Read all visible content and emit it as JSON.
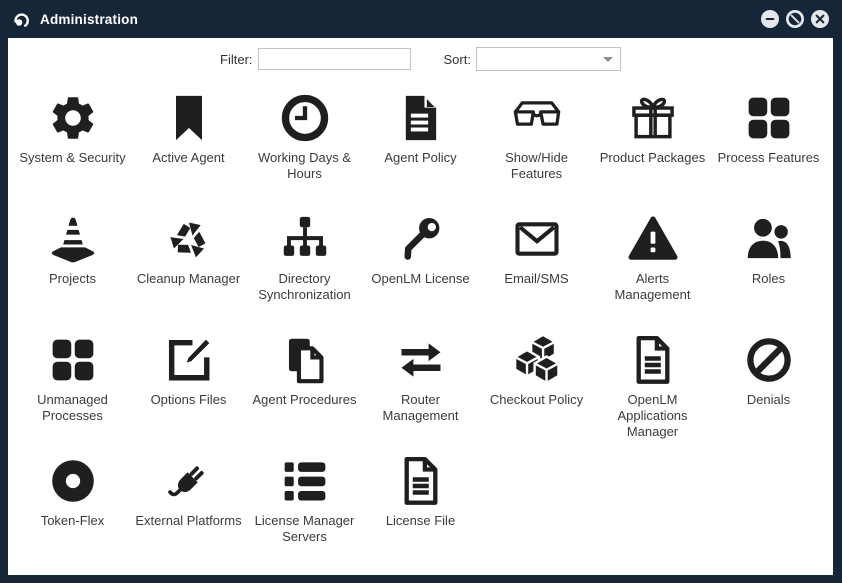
{
  "window": {
    "title": "Administration",
    "logo_icon": "openlm-logo-icon",
    "controls": [
      {
        "id": "minimize",
        "icon": "minus-circle"
      },
      {
        "id": "block",
        "icon": "slashed-circle"
      },
      {
        "id": "close",
        "icon": "x-circle"
      }
    ]
  },
  "toolbar": {
    "filter_label": "Filter:",
    "filter_value": "",
    "sort_label": "Sort:",
    "sort_value": ""
  },
  "colors": {
    "titlebar_bg": "#162639",
    "content_bg": "#FFFFFF",
    "icon": "#1F1F1F",
    "label_text": "#3B3B3B",
    "control_bg": "#E4E8EB",
    "field_border": "#BFC3C7"
  },
  "grid": {
    "items": [
      {
        "label": "System & Security",
        "icon": "gear"
      },
      {
        "label": "Active Agent",
        "icon": "bookmark"
      },
      {
        "label": "Working Days &\nHours",
        "icon": "clock"
      },
      {
        "label": "Agent Policy",
        "icon": "document-filled"
      },
      {
        "label": "Show/Hide\nFeatures",
        "icon": "glasses"
      },
      {
        "label": "Product Packages",
        "icon": "gift"
      },
      {
        "label": "Process Features",
        "icon": "grid-squares"
      },
      {
        "label": "Projects",
        "icon": "traffic-cone"
      },
      {
        "label": "Cleanup Manager",
        "icon": "recycle"
      },
      {
        "label": "Directory\nSynchronization",
        "icon": "sitemap"
      },
      {
        "label": "OpenLM License",
        "icon": "key"
      },
      {
        "label": "Email/SMS",
        "icon": "envelope"
      },
      {
        "label": "Alerts\nManagement",
        "icon": "warning-triangle"
      },
      {
        "label": "Roles",
        "icon": "people"
      },
      {
        "label": "Unmanaged\nProcesses",
        "icon": "grid-squares"
      },
      {
        "label": "Options Files",
        "icon": "edit-square"
      },
      {
        "label": "Agent Procedures",
        "icon": "documents"
      },
      {
        "label": "Router\nManagement",
        "icon": "transfer-arrows"
      },
      {
        "label": "Checkout Policy",
        "icon": "cubes"
      },
      {
        "label": "OpenLM\nApplications\nManager",
        "icon": "document-lines"
      },
      {
        "label": "Denials",
        "icon": "ban"
      },
      {
        "label": "Token-Flex",
        "icon": "donut"
      },
      {
        "label": "External Platforms",
        "icon": "plug"
      },
      {
        "label": "License Manager\nServers",
        "icon": "server-list"
      },
      {
        "label": "License File",
        "icon": "document-lines"
      }
    ]
  }
}
